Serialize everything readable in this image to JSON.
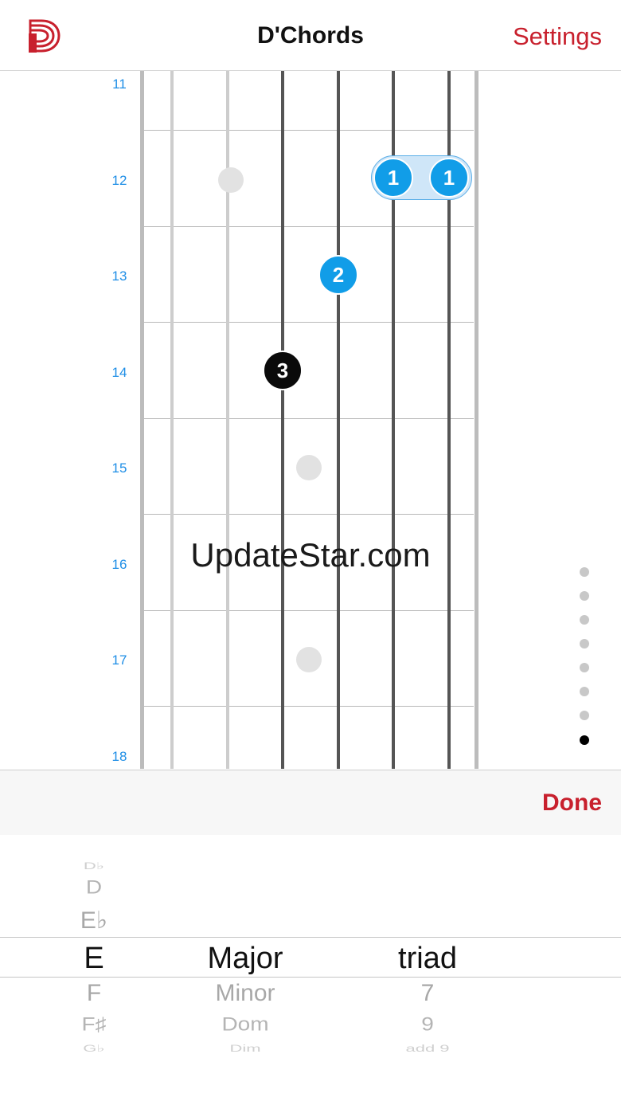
{
  "nav": {
    "title": "D'Chords",
    "settings_label": "Settings"
  },
  "colors": {
    "accent": "#c8202d",
    "finger_blue": "#119de8",
    "fret_number": "#1e8ee6"
  },
  "fretboard": {
    "fret_numbers": [
      "11",
      "12",
      "13",
      "14",
      "15",
      "16",
      "17",
      "18"
    ],
    "fingers": [
      {
        "label": "1",
        "fret": "12",
        "string": 5,
        "color": "blue"
      },
      {
        "label": "1",
        "fret": "12",
        "string": 6,
        "color": "blue"
      },
      {
        "label": "2",
        "fret": "13",
        "string": 4,
        "color": "blue"
      },
      {
        "label": "3",
        "fret": "14",
        "string": 3,
        "color": "black"
      }
    ],
    "barre": {
      "fret": "12",
      "from_string": 5,
      "to_string": 6
    },
    "watermark": "UpdateStar.com",
    "page_indicator": {
      "count": 8,
      "active": 8
    }
  },
  "toolbar": {
    "done_label": "Done"
  },
  "picker": {
    "root": {
      "items": [
        "D♭",
        "D",
        "E♭",
        "E",
        "F",
        "F♯",
        "G♭"
      ],
      "selected": "E"
    },
    "quality": {
      "items": [
        "Major",
        "Minor",
        "Dom",
        "Dim"
      ],
      "selected": "Major"
    },
    "extension": {
      "items": [
        "triad",
        "7",
        "9",
        "add 9"
      ],
      "selected": "triad"
    }
  }
}
